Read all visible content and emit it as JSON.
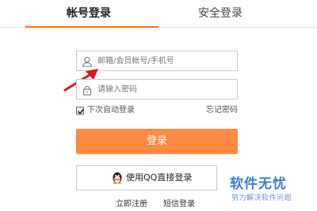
{
  "tabs": {
    "account": "帐号登录",
    "secure": "安全登录"
  },
  "form": {
    "username_placeholder": "邮箱/会员帐号/手机号",
    "password_placeholder": "请输入密码",
    "auto_login_label": "下次自动登录",
    "auto_login_checked": true,
    "forgot_password": "忘记密码",
    "login_button": "登录",
    "qq_login_button": "使用QQ直接登录"
  },
  "links": {
    "register": "立即注册",
    "sms_login": "短信登录"
  },
  "watermark": {
    "title": "软件无忧",
    "subtitle": "努力解决软件问题"
  },
  "colors": {
    "accent": "#ff6b1a",
    "login_button": "#ff8a41",
    "annotation_arrow": "#e0161a",
    "watermark": "#3f7bd0"
  },
  "icons": {
    "username": "user-icon",
    "password": "lock-icon",
    "qq": "qq-penguin-icon"
  }
}
